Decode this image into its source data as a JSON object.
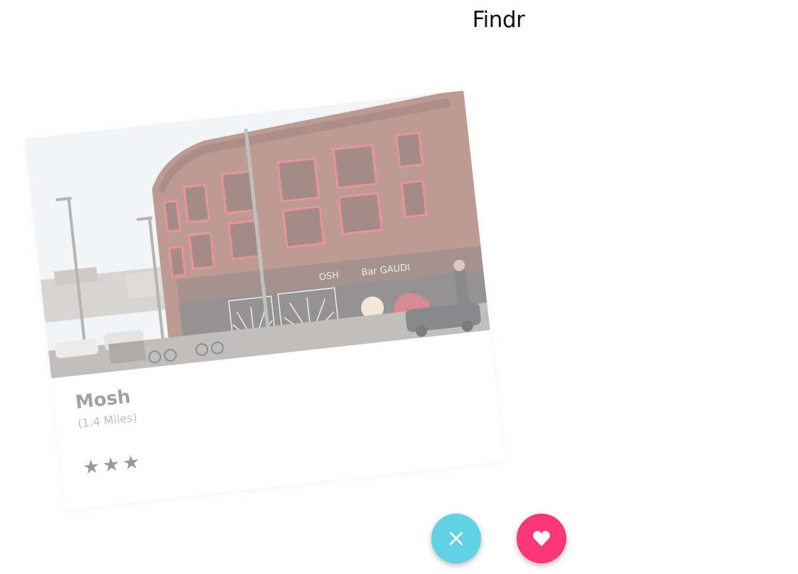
{
  "app": {
    "title": "Findr"
  },
  "card": {
    "name": "Mosh",
    "distance": "(1.4 Miles)",
    "rating": 3,
    "stars": [
      "★",
      "★",
      "★"
    ],
    "photo_signs": {
      "left_sign": "OSH",
      "right_sign": "Bar GAUDI"
    }
  },
  "actions": {
    "reject_icon": "close-icon",
    "like_icon": "heart-icon"
  },
  "colors": {
    "reject": "#5fd3e4",
    "like": "#fe3577",
    "brick": "#8a4a3a",
    "window_frame": "#d43f4a"
  }
}
